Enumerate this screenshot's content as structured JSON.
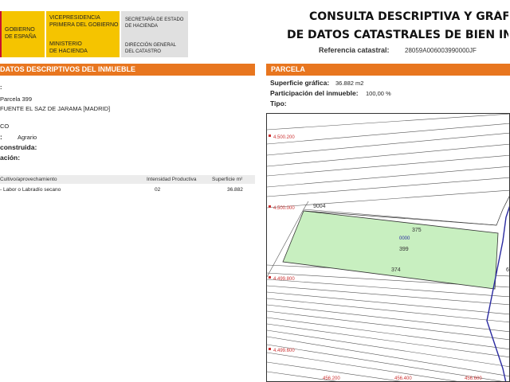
{
  "header": {
    "logo_block1": [
      "GOBIERNO",
      "DE ESPAÑA"
    ],
    "logo_block2_top": [
      "VICEPRESIDENCIA",
      "PRIMERA DEL GOBIERNO"
    ],
    "logo_block2_bottom": [
      "MINISTERIO",
      "DE HACIENDA"
    ],
    "logo_block3_top": [
      "SECRETARÍA DE ESTADO",
      "DE HACIENDA"
    ],
    "logo_block3_bottom": [
      "DIRECCIÓN GENERAL",
      "DEL CATASTRO"
    ],
    "title_line1": "CONSULTA DESCRIPTIVA Y GRÁFICA",
    "title_line2": "DE DATOS CATASTRALES DE BIEN INMUEBLE",
    "ref_label": "Referencia catastral:",
    "ref_value": "28059A006003990000JF"
  },
  "left": {
    "section_title": "DATOS DESCRIPTIVOS DEL INMUEBLE",
    "fields": [
      {
        "label": ":",
        "value": ""
      },
      {
        "label": "",
        "value": "Parcela 399"
      },
      {
        "label": "",
        "value": "FUENTE EL SAZ DE JARAMA [MADRID]"
      },
      {
        "label": "",
        "value": "CO"
      },
      {
        "label": ":",
        "value": "Agrario"
      },
      {
        "label": "construida:",
        "value": ""
      },
      {
        "label": "ación:",
        "value": ""
      }
    ],
    "table": {
      "headers": [
        "Cultivo/aprovechamiento",
        "Intensidad Productiva",
        "Superficie m²"
      ],
      "rows": [
        [
          "- Labor o Labradío secano",
          "02",
          "36.882"
        ]
      ]
    }
  },
  "right": {
    "section_title": "PARCELA",
    "fields": [
      {
        "label": "Superficie gráfica:",
        "value": "36.882 m2"
      },
      {
        "label": "Participación del inmueble:",
        "value": "100,00 %"
      },
      {
        "label": "Tipo:",
        "value": ""
      }
    ],
    "map": {
      "coords_y": [
        "4.500.200",
        "4.500.000",
        "4.499.800",
        "4.499.600"
      ],
      "coords_x": [
        "456.200",
        "456.400",
        "456.600"
      ],
      "parcel_labels": [
        "9004",
        "375",
        "399",
        "374",
        "6"
      ],
      "parcel_id": "0000"
    }
  },
  "colors": {
    "accent": "#e8761f",
    "logo_yellow": "#f5c400",
    "parcel_fill": "#c8efc0",
    "boundary": "#2a2aa0"
  }
}
